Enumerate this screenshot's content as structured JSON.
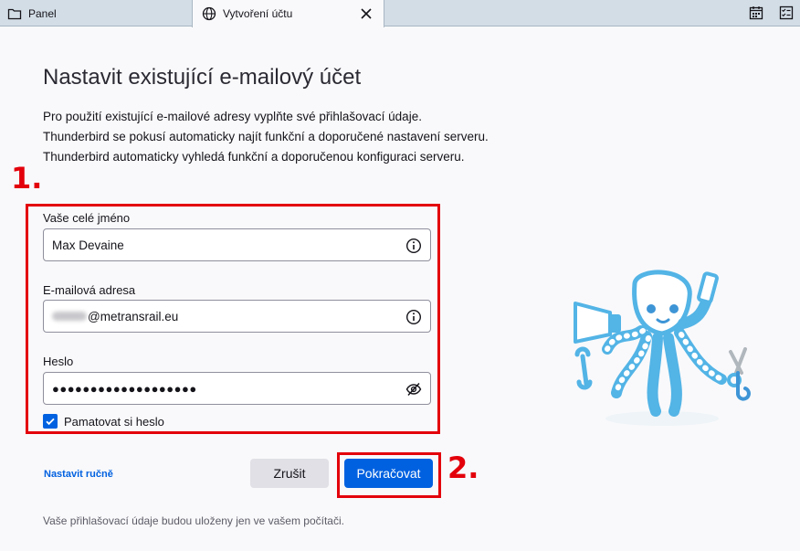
{
  "tabs": [
    {
      "label": "Panel",
      "icon": "folder-icon"
    },
    {
      "label": "Vytvoření účtu",
      "icon": "globe-icon",
      "active": true
    }
  ],
  "toolbar": {
    "icons": [
      "calendar-icon",
      "tasks-icon"
    ]
  },
  "page": {
    "title": "Nastavit existující e-mailový účet",
    "description": [
      "Pro použití existující e-mailové adresy vyplňte své přihlašovací údaje.",
      "Thunderbird se pokusí automaticky najít funkční a doporučené nastavení serveru.",
      "Thunderbird automaticky vyhledá funkční a doporučenou konfiguraci serveru."
    ]
  },
  "annotations": {
    "step1": "1.",
    "step2": "2."
  },
  "form": {
    "name": {
      "label": "Vaše celé jméno",
      "value": "Max Devaine",
      "icon": "info-icon"
    },
    "email": {
      "label": "E-mailová adresa",
      "value": "@metransrail.eu",
      "icon": "info-icon"
    },
    "password": {
      "label": "Heslo",
      "value": "●●●●●●●●●●●●●●●●●●●",
      "icon": "eye-slash-icon"
    },
    "remember": {
      "label": "Pamatovat si heslo",
      "checked": true
    }
  },
  "actions": {
    "manual": "Nastavit ručně",
    "cancel": "Zrušit",
    "continue": "Pokračovat"
  },
  "footer": "Vaše přihlašovací údaje budou uloženy jen ve vašem počítači.",
  "colors": {
    "accent": "#0061e0",
    "annotation": "#e3000b",
    "mascot": "#53b4e6"
  }
}
